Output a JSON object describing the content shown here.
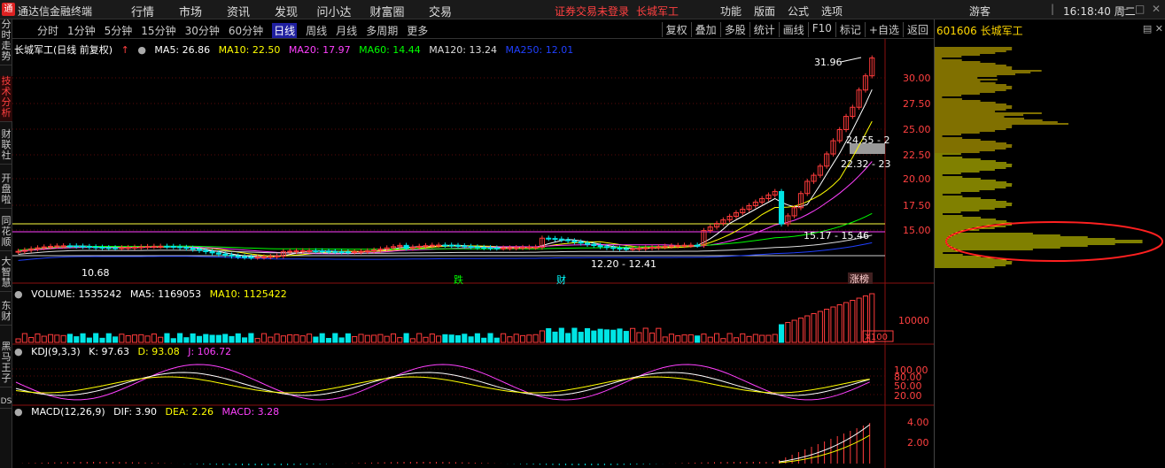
{
  "app": {
    "title": "通达信金融终端",
    "menu": [
      "行情",
      "市场",
      "资讯",
      "发现",
      "问小达",
      "财富圈",
      "交易"
    ],
    "login_warning": "证券交易未登录",
    "stock_name": "长城军工",
    "right_menu": [
      "功能",
      "版面",
      "公式",
      "选项"
    ],
    "user": "游客",
    "time": "16:18:40 周二"
  },
  "left_tabs": [
    {
      "label": "分时走势",
      "active": false
    },
    {
      "label": "技术分析",
      "active": true
    },
    {
      "label": "财联社",
      "active": false
    },
    {
      "label": "开盘啦",
      "active": false
    },
    {
      "label": "同花顺",
      "active": false
    },
    {
      "label": "大智慧",
      "active": false
    },
    {
      "label": "东财",
      "active": false
    },
    {
      "label": "黑马王子",
      "active": false
    },
    {
      "label": "DS",
      "active": false
    }
  ],
  "periods": [
    {
      "label": "分时",
      "active": false
    },
    {
      "label": "1分钟",
      "active": false
    },
    {
      "label": "5分钟",
      "active": false
    },
    {
      "label": "15分钟",
      "active": false
    },
    {
      "label": "30分钟",
      "active": false
    },
    {
      "label": "60分钟",
      "active": false
    },
    {
      "label": "日线",
      "active": true
    },
    {
      "label": "周线",
      "active": false
    },
    {
      "label": "月线",
      "active": false
    },
    {
      "label": "多周期",
      "active": false
    },
    {
      "label": "更多",
      "active": false
    }
  ],
  "tools": [
    "复权",
    "叠加",
    "多股",
    "统计",
    "画线",
    "F10",
    "标记",
    "+自选",
    "返回"
  ],
  "main": {
    "title": "长城军工(日线 前复权)",
    "ma": [
      {
        "label": "MA5: 26.86",
        "color": "#ffffff"
      },
      {
        "label": "MA10: 22.50",
        "color": "#ffff00"
      },
      {
        "label": "MA20: 17.97",
        "color": "#ff40ff"
      },
      {
        "label": "MA60: 14.44",
        "color": "#00ff00"
      },
      {
        "label": "MA120: 13.24",
        "color": "#dddddd"
      },
      {
        "label": "MA250: 12.01",
        "color": "#2040ff"
      }
    ],
    "price_ticks": [
      "30.00",
      "27.50",
      "25.00",
      "22.50",
      "20.00",
      "17.50",
      "15.00"
    ],
    "labels": {
      "high": "31.96",
      "low": "10.68",
      "range1": "24.55 - 2",
      "range2": "22.32 - 23",
      "range3": "15.17 - 15.46",
      "range4": "12.20 - 12.41",
      "mark_die": "跌",
      "mark_cai": "财",
      "mark_zhang": "涨榜"
    }
  },
  "volume": {
    "label": "VOLUME: 1535242",
    "ma5": "MA5: 1169053",
    "ma10": "MA10: 1125422",
    "tick": "10000",
    "unit": "X100"
  },
  "kdj": {
    "label": "KDJ(9,3,3)",
    "k": "K: 97.63",
    "d": "D: 93.08",
    "j": "J: 106.72",
    "ticks": [
      "100.00",
      "80.00",
      "50.00",
      "20.00"
    ]
  },
  "macd": {
    "label": "MACD(12,26,9)",
    "dif": "DIF: 3.90",
    "dea": "DEA: 2.26",
    "macd": "MACD: 3.28",
    "ticks": [
      "4.00",
      "2.00"
    ]
  },
  "right_panel": {
    "code": "601606 长城军工"
  },
  "colors": {
    "up": "#ff3b3b",
    "down": "#00e5e5",
    "chip": "#ffff00",
    "highlight": "#ff2020"
  }
}
